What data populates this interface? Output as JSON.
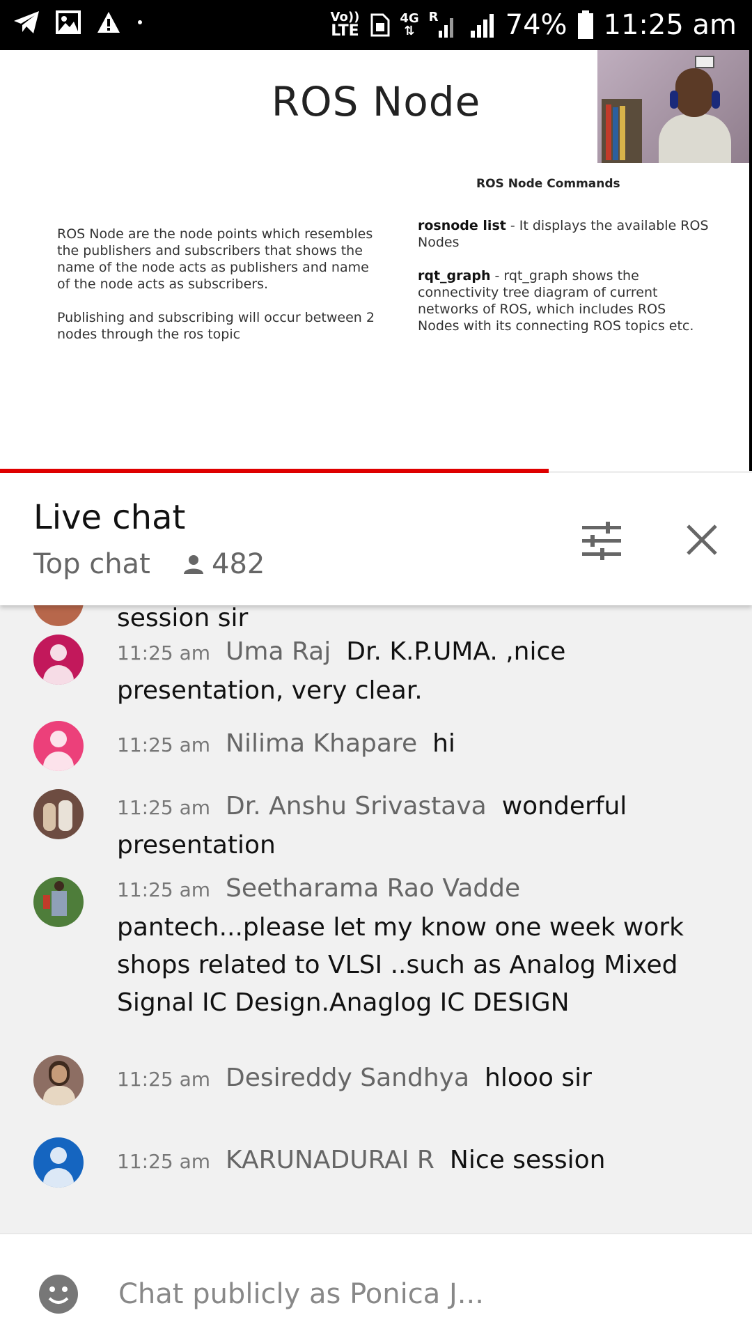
{
  "status_bar": {
    "network_label": "Vo))\nLTE",
    "network_line1": "Vo))",
    "network_line2": "LTE",
    "data_label": "4G",
    "roaming_label": "R",
    "battery_percent": "74%",
    "time": "11:25 am"
  },
  "video": {
    "progress": 0.73,
    "slide": {
      "title": "ROS Node",
      "commands_title": "ROS Node Commands",
      "left_paragraphs": [
        "ROS Node are the node points which resembles the publishers and subscribers that shows the name of the node acts as publishers and name of the node acts as subscribers.",
        "Publishing and subscribing will occur between 2 nodes through the ros topic"
      ],
      "commands": [
        {
          "name": "rosnode list",
          "desc": " - It displays the available ROS Nodes"
        },
        {
          "name": "rqt_graph",
          "desc": " - rqt_graph shows the connectivity tree diagram of current networks of ROS, which includes ROS Nodes with its connecting ROS topics etc."
        }
      ]
    }
  },
  "chat": {
    "title": "Live chat",
    "mode_label": "Top chat",
    "viewer_count": "482",
    "partial_message": "session sir",
    "messages": [
      {
        "time": "11:25 am",
        "author": "Uma Raj",
        "text": "Dr. K.P.UMA. ,nice presentation, very clear.",
        "avatar_color": "#c2185b"
      },
      {
        "time": "11:25 am",
        "author": "Nilima Khapare",
        "text": "hi",
        "avatar_color": "#ec407a"
      },
      {
        "time": "11:25 am",
        "author": "Dr. Anshu Srivastava",
        "text": "wonderful presentation",
        "avatar_color": "#6d4c41"
      },
      {
        "time": "11:25 am",
        "author": "Seetharama Rao Vadde",
        "text": "pantech...please let my know one week work shops related to VLSI ..such as Analog Mixed Signal IC Design.Anaglog IC DESIGN",
        "avatar_color": "#4e7d3a"
      },
      {
        "time": "11:25 am",
        "author": "Desireddy Sandhya",
        "text": "hlooo sir",
        "avatar_color": "#8d6e63"
      },
      {
        "time": "11:25 am",
        "author": "KARUNADURAI R",
        "text": "Nice session",
        "avatar_color": "#1565c0"
      }
    ],
    "input_placeholder": "Chat publicly as Ponica J..."
  }
}
